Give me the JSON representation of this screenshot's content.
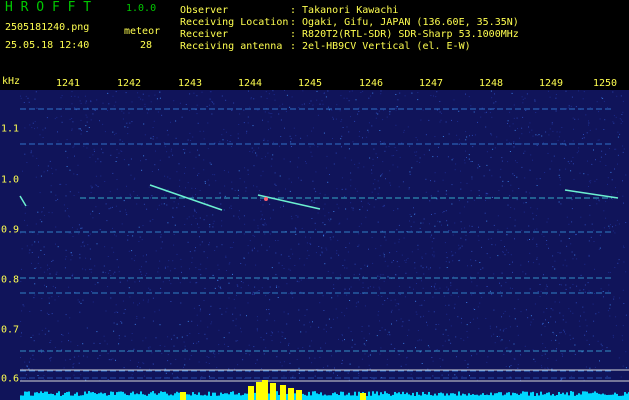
{
  "app": {
    "logo": "H R O F F T",
    "version": "1.0.0"
  },
  "file": {
    "name": "2505181240.png",
    "datetime": "25.05.18 12:40"
  },
  "meteor": {
    "label": "meteor",
    "count": "28"
  },
  "info": {
    "observer": {
      "label": "Observer",
      "value": ": Takanori Kawachi"
    },
    "location": {
      "label": "Receiving Location",
      "value": ": Ogaki, Gifu, JAPAN (136.60E, 35.35N)"
    },
    "receiver": {
      "label": "Receiver",
      "value": ": R820T2(RTL-SDR) SDR-Sharp 53.1000MHz"
    },
    "antenna": {
      "label": "Receiving antenna",
      "value": ": 2el-HB9CV Vertical (el. E-W)"
    }
  },
  "axes": {
    "y_unit": "kHz",
    "x_ticks": [
      "1241",
      "1242",
      "1243",
      "1244",
      "1245",
      "1246",
      "1247",
      "1248",
      "1249",
      "1250"
    ],
    "y_ticks": [
      "1.1",
      "1.0",
      "0.9",
      "0.8",
      "0.7",
      "0.6"
    ]
  },
  "colors": {
    "background": "#10145a",
    "text": "#ffff50",
    "logo": "#00c800",
    "baseline": "#00d8ff",
    "peak": "#ffff00"
  }
}
